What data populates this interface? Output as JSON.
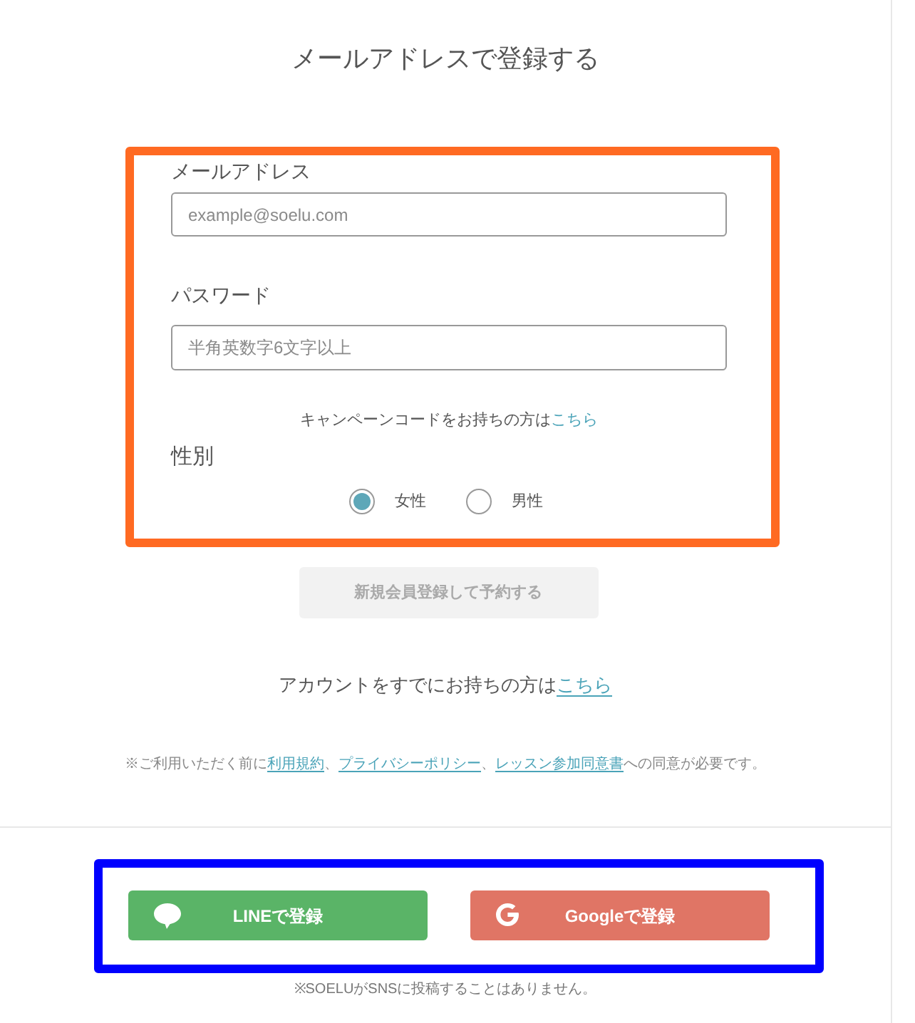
{
  "title": "メールアドレスで登録する",
  "form": {
    "highlight": {
      "color": "#ff6a22"
    },
    "fields": [
      {
        "label": "メールアドレス",
        "placeholder": "example@soelu.com"
      },
      {
        "label": "パスワード",
        "placeholder": "半角英数字6文字以上"
      }
    ],
    "campaign_code": {
      "text": "キャンペーンコードをお持ちの方は",
      "link": "こちら"
    },
    "gender": {
      "label": "性別",
      "options": [
        {
          "label": "女性",
          "selected": true
        },
        {
          "label": "男性",
          "selected": false
        }
      ]
    }
  },
  "submit_button": {
    "label": "新規会員登録して予約する",
    "disabled": true
  },
  "login": {
    "text": "アカウントをすでにお持ちの方は",
    "link": "こちら"
  },
  "terms": {
    "parts": [
      {
        "kind": "text",
        "text": "※ご利用いただく前に"
      },
      {
        "kind": "link",
        "text": "利用規約"
      },
      {
        "kind": "text",
        "text": "、"
      },
      {
        "kind": "link",
        "text": "プライバシーポリシー"
      },
      {
        "kind": "text",
        "text": "、"
      },
      {
        "kind": "link",
        "text": "レッスン参加同意書"
      },
      {
        "kind": "text",
        "text": "への同意が必要です。"
      }
    ]
  },
  "social": {
    "highlight": {
      "color": "#0000ff"
    },
    "buttons": [
      {
        "kind": "line",
        "label": "LINEで登録",
        "color": "#5ab467"
      },
      {
        "kind": "google",
        "label": "Googleで登録",
        "color": "#e07565"
      }
    ],
    "note": "※SOELUがSNSに投稿することはありません。"
  }
}
